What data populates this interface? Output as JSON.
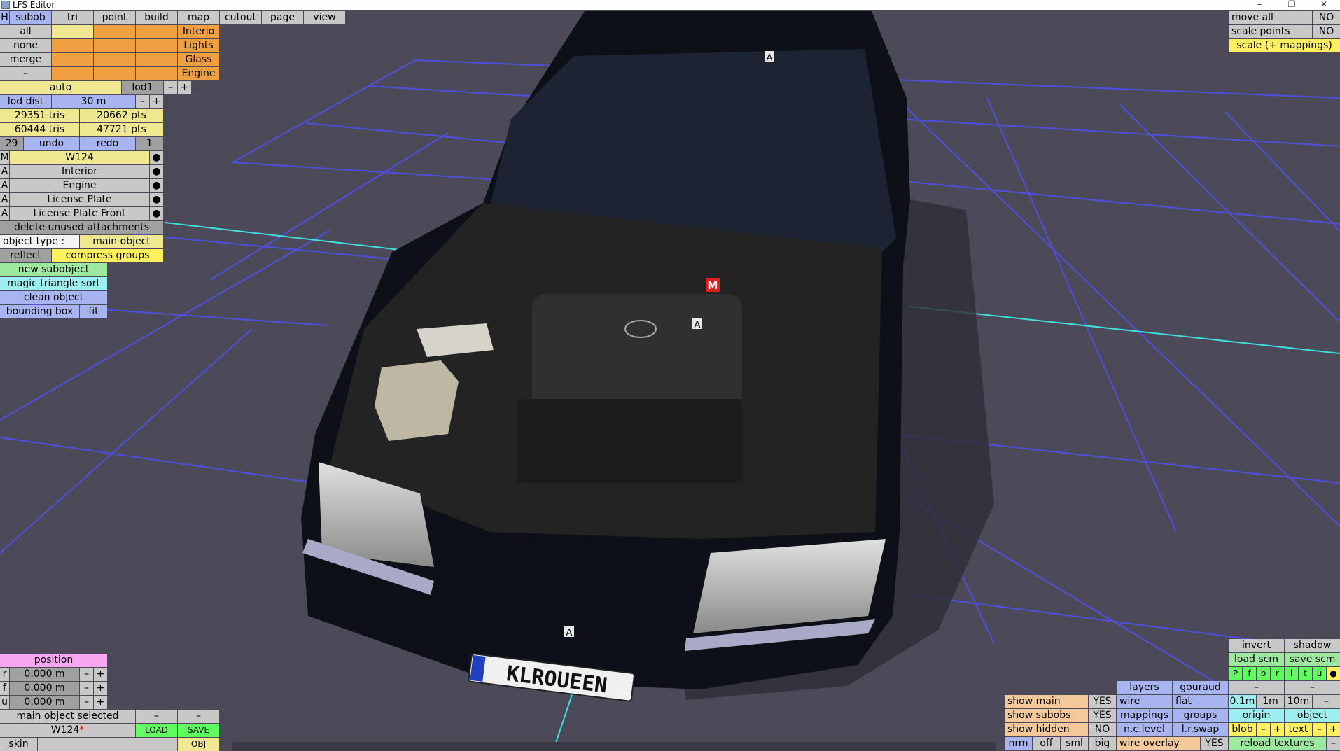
{
  "window": {
    "title": "LFS Editor",
    "min": "–",
    "max": "❐",
    "close": "✕"
  },
  "colors": {
    "sky": "#4c4a58",
    "grid": "#5050e0",
    "axis": "#40e0e0",
    "car": "#0d1117"
  },
  "top_tabs": {
    "h": "H",
    "tabs": [
      "subob",
      "tri",
      "point",
      "build",
      "map",
      "cutout",
      "page",
      "view"
    ]
  },
  "sel_buttons": [
    "all",
    "none",
    "merge",
    "–"
  ],
  "layers": [
    "Interio",
    "Lights",
    "Glass",
    "Engine"
  ],
  "lod": {
    "auto": "auto",
    "level": "lod1",
    "minus": "–",
    "plus": "+",
    "dist_label": "lod dist",
    "dist_value": "30 m"
  },
  "stats": {
    "tris1": "29351 tris",
    "pts1": "20662 pts",
    "tris2": "60444 tris",
    "pts2": "47721 pts"
  },
  "undo": {
    "count": "29",
    "undo": "undo",
    "redo": "redo",
    "redo_count": "1"
  },
  "objects": [
    {
      "flag": "M",
      "name": "W124",
      "dot": "●"
    },
    {
      "flag": "A",
      "name": "Interior",
      "dot": "●"
    },
    {
      "flag": "A",
      "name": "Engine",
      "dot": "●"
    },
    {
      "flag": "A",
      "name": "License Plate",
      "dot": "●"
    },
    {
      "flag": "A",
      "name": "License Plate Front",
      "dot": "●"
    }
  ],
  "actions": {
    "delete_unused": "delete unused attachments",
    "object_type_label": "object type :",
    "object_type_value": "main object",
    "reflect": "reflect",
    "compress": "compress groups",
    "new_subobject": "new subobject",
    "magic_sort": "magic triangle sort",
    "clean": "clean object",
    "bounding_box": "bounding box",
    "fit": "fit"
  },
  "position": {
    "title": "position",
    "rows": [
      {
        "axis": "r",
        "value": "0.000 m",
        "minus": "–",
        "plus": "+"
      },
      {
        "axis": "f",
        "value": "0.000 m",
        "minus": "–",
        "plus": "+"
      },
      {
        "axis": "u",
        "value": "0.000 m",
        "minus": "–",
        "plus": "+"
      }
    ]
  },
  "file": {
    "status": "main object selected",
    "dash": "–",
    "name": "W124",
    "modified": "*",
    "load": "LOAD",
    "save": "SAVE",
    "skin": "skin",
    "obj": "OBJ"
  },
  "top_right": {
    "move_all": "move all",
    "move_all_val": "NO",
    "scale_points": "scale points",
    "scale_points_val": "NO",
    "scale_map": "scale (+ mappings)"
  },
  "view_panel": {
    "show_main": "show main",
    "show_main_val": "YES",
    "show_subobs": "show subobs",
    "show_subobs_val": "YES",
    "show_hidden": "show hidden",
    "show_hidden_val": "NO",
    "nrm": "nrm",
    "off": "off",
    "sml": "sml",
    "big": "big",
    "layers": "layers",
    "gouraud": "gouraud",
    "wire": "wire",
    "flat": "flat",
    "mappings": "mappings",
    "groups": "groups",
    "nc_level": "n.c.level",
    "lr_swap": "l.r.swap",
    "wire_overlay": "wire overlay",
    "wire_overlay_val": "YES",
    "invert": "invert",
    "shadow": "shadow",
    "load_scm": "load scm",
    "save_scm": "save scm",
    "letters": [
      "P",
      "f",
      "b",
      "r",
      "l",
      "t",
      "u",
      "●"
    ],
    "dash": "–",
    "sizes": [
      "0.1m",
      "1m",
      "10m",
      "–"
    ],
    "origin": "origin",
    "object": "object",
    "blob": "blob",
    "text": "text",
    "minus": "–",
    "plus": "+",
    "reload": "reload textures"
  },
  "viewport": {
    "plate": "KLROUEEN",
    "badge_m": "M",
    "badge_a": "A"
  }
}
